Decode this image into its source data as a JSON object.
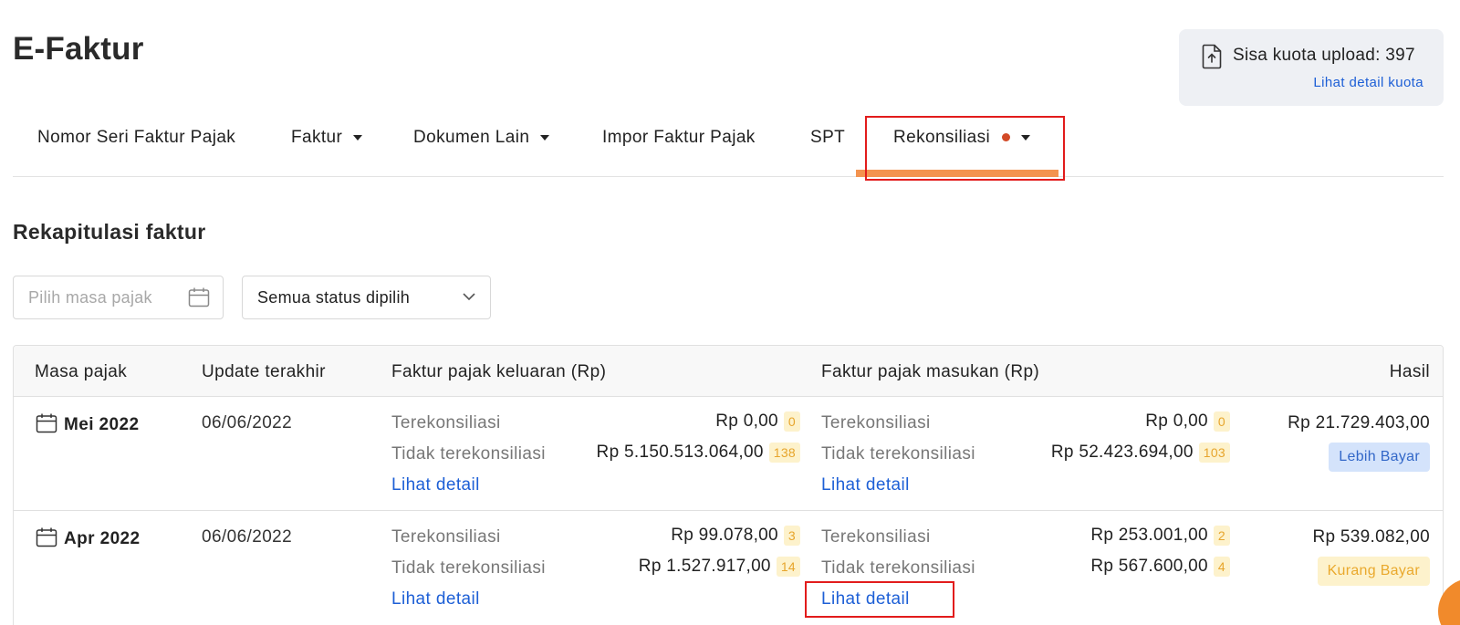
{
  "page": {
    "title": "E-Faktur"
  },
  "quota": {
    "label": "Sisa kuota upload: 397",
    "link": "Lihat detail kuota",
    "icon": "upload-file-icon"
  },
  "nav": {
    "items": [
      {
        "label": "Nomor Seri Faktur Pajak",
        "has_dropdown": false
      },
      {
        "label": "Faktur",
        "has_dropdown": true
      },
      {
        "label": "Dokumen Lain",
        "has_dropdown": true
      },
      {
        "label": "Impor Faktur Pajak",
        "has_dropdown": false
      },
      {
        "label": "SPT",
        "has_dropdown": false
      },
      {
        "label": "Rekonsiliasi",
        "has_dropdown": true,
        "active": true,
        "has_notification_dot": true
      }
    ],
    "active_color": "#f3934f"
  },
  "section": {
    "title": "Rekapitulasi faktur"
  },
  "filters": {
    "period_placeholder": "Pilih masa pajak",
    "status_value": "Semua status dipilih"
  },
  "table": {
    "headers": {
      "period": "Masa pajak",
      "updated": "Update terakhir",
      "output": "Faktur pajak keluaran (Rp)",
      "input": "Faktur pajak masukan (Rp)",
      "result": "Hasil"
    },
    "rows": [
      {
        "period": "Mei 2022",
        "updated": "06/06/2022",
        "output": {
          "reconciled_label": "Terekonsiliasi",
          "reconciled_amount": "Rp 0,00",
          "reconciled_count": "0",
          "unreconciled_label": "Tidak terekonsiliasi",
          "unreconciled_amount": "Rp 5.150.513.064,00",
          "unreconciled_count": "138",
          "detail_link": "Lihat detail"
        },
        "input": {
          "reconciled_label": "Terekonsiliasi",
          "reconciled_amount": "Rp 0,00",
          "reconciled_count": "0",
          "unreconciled_label": "Tidak terekonsiliasi",
          "unreconciled_amount": "Rp 52.423.694,00",
          "unreconciled_count": "103",
          "detail_link": "Lihat detail"
        },
        "result_amount": "Rp 21.729.403,00",
        "result_status": "Lebih Bayar"
      },
      {
        "period": "Apr 2022",
        "updated": "06/06/2022",
        "output": {
          "reconciled_label": "Terekonsiliasi",
          "reconciled_amount": "Rp 99.078,00",
          "reconciled_count": "3",
          "unreconciled_label": "Tidak terekonsiliasi",
          "unreconciled_amount": "Rp 1.527.917,00",
          "unreconciled_count": "14",
          "detail_link": "Lihat detail"
        },
        "input": {
          "reconciled_label": "Terekonsiliasi",
          "reconciled_amount": "Rp 253.001,00",
          "reconciled_count": "2",
          "unreconciled_label": "Tidak terekonsiliasi",
          "unreconciled_amount": "Rp 567.600,00",
          "unreconciled_count": "4",
          "detail_link": "Lihat detail"
        },
        "result_amount": "Rp 539.082,00",
        "result_status": "Kurang Bayar"
      }
    ]
  },
  "colors": {
    "link": "#1d5fd6",
    "highlight": "#e21c1c",
    "badge_lebih_bg": "#d4e3fb",
    "badge_kurang_bg": "#fdf2cc",
    "fab": "#f18a2b"
  }
}
